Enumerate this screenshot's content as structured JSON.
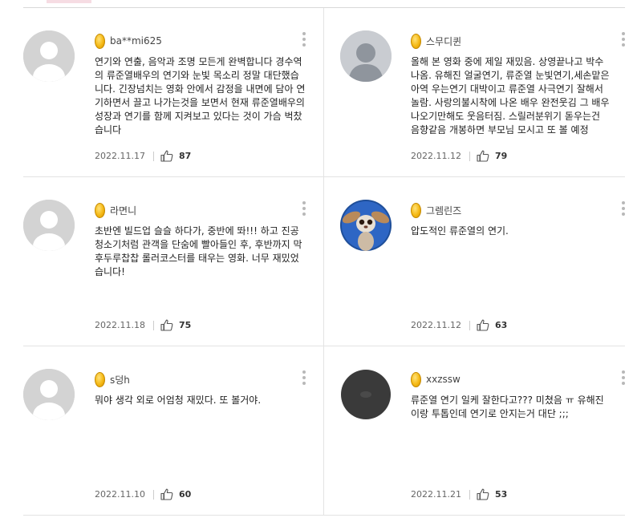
{
  "reviews": [
    {
      "nickname": "ba**mi625",
      "avatar": "default",
      "text": "연기와 연출, 음악과 조명 모든게 완벽합니다 경수역의 류준열배우의 연기와 눈빛 목소리 정말 대단했습니다. 긴장넘치는 영화 안에서 감정을 내면에 담아 연기하면서 끌고 나가는것을 보면서 현재 류준열배우의 성장과 연기를 함께 지켜보고 있다는 것이 가슴 벅찼습니다",
      "date": "2022.11.17",
      "likes": "87"
    },
    {
      "nickname": "스무디퀸",
      "avatar": "person-silhouette",
      "text": "올해 본 영화 중에 제일 재밌음. 상영끝나고 박수나옴. 유해진 얼굴연기, 류준열 눈빛연기,세손맡은 아역 우는연기 대박이고 류준열 사극연기 잘해서 놀람. 사랑의불시착에 나온 배우 완전웃김 그 배우 나오기만해도 웃음터짐. 스릴러분위기 돋우는건 음향같음 개봉하면 부모님 모시고 또 볼 예정",
      "date": "2022.11.12",
      "likes": "79"
    },
    {
      "nickname": "라면니",
      "avatar": "default",
      "text": "초반엔 빌드업 슬슬 하다가, 중반에 똬!!! 하고 진공청소기처럼 관객을 단숨에 빨아들인 후, 후반까지 막 후두루찹찹 롤러코스터를 태우는 영화. 너무 재밌었습니다!",
      "date": "2022.11.18",
      "likes": "75"
    },
    {
      "nickname": "그렘린즈",
      "avatar": "gremlin-photo",
      "text": "압도적인 류준열의 연기.",
      "date": "2022.11.12",
      "likes": "63"
    },
    {
      "nickname": "s덩h",
      "avatar": "default",
      "text": "뭐야 생각 외로 어엄청 재밌다. 또 볼거야.",
      "date": "2022.11.10",
      "likes": "60"
    },
    {
      "nickname": "xxzssw",
      "avatar": "dark-circle",
      "text": "류준열 연기 일케 잘한다고??? 미쳤음 ㅠ 유해진이랑 투톱인데 연기로 안지는거 대단 ;;;",
      "date": "2022.11.21",
      "likes": "53"
    }
  ],
  "icons": {
    "coin": "gold-coin-icon",
    "more": "more-vertical-icon",
    "like": "thumbs-up-icon"
  },
  "colors": {
    "accent_tab": "#f6dce3",
    "coin": "#f5b915",
    "divider": "#e3e3e3"
  }
}
